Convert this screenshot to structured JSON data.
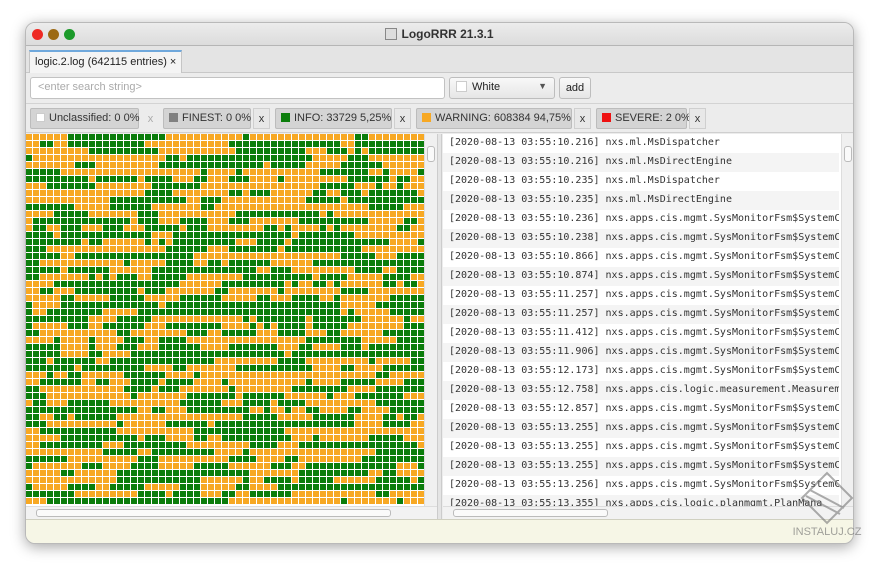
{
  "window": {
    "title": "LogoRRR 21.3.1"
  },
  "tab": {
    "label": "logic.2.log (642115 entries)",
    "close": "×"
  },
  "search": {
    "placeholder": "<enter search string>",
    "color_value": "White",
    "add_label": "add"
  },
  "filters": [
    {
      "label": "Unclassified: 0 0%",
      "color": "#ffffff",
      "close": "x"
    },
    {
      "label": "FINEST: 0 0%",
      "color": "#808080",
      "close": "x"
    },
    {
      "label": "INFO: 33729 5,25%",
      "color": "#0b7d0b",
      "close": "x"
    },
    {
      "label": "WARNING: 608384 94,75%",
      "color": "#f7a823",
      "close": "x"
    },
    {
      "label": "SEVERE: 2 0%",
      "color": "#ee1111",
      "close": "x"
    }
  ],
  "colors": {
    "info": "#0b7d0b",
    "warning": "#f7a823"
  },
  "log_lines": [
    "[2020-08-13 03:55:10.216] nxs.ml.MsDispatcher",
    "[2020-08-13 03:55:10.216] nxs.ml.MsDirectEngine",
    "[2020-08-13 03:55:10.235] nxs.ml.MsDispatcher",
    "[2020-08-13 03:55:10.235] nxs.ml.MsDirectEngine",
    "[2020-08-13 03:55:10.236] nxs.apps.cis.mgmt.SysMonitorFsm$SystemCo",
    "[2020-08-13 03:55:10.238] nxs.apps.cis.mgmt.SysMonitorFsm$SystemCo",
    "[2020-08-13 03:55:10.866] nxs.apps.cis.mgmt.SysMonitorFsm$SystemCo",
    "[2020-08-13 03:55:10.874] nxs.apps.cis.mgmt.SysMonitorFsm$SystemCo",
    "[2020-08-13 03:55:11.257] nxs.apps.cis.mgmt.SysMonitorFsm$SystemCo",
    "[2020-08-13 03:55:11.257] nxs.apps.cis.mgmt.SysMonitorFsm$SystemCo",
    "[2020-08-13 03:55:11.412] nxs.apps.cis.mgmt.SysMonitorFsm$SystemCo",
    "[2020-08-13 03:55:11.906] nxs.apps.cis.mgmt.SysMonitorFsm$SystemCo",
    "[2020-08-13 03:55:12.173] nxs.apps.cis.mgmt.SysMonitorFsm$SystemCo",
    "[2020-08-13 03:55:12.758] nxs.apps.cis.logic.measurement.Measureme",
    "[2020-08-13 03:55:12.857] nxs.apps.cis.mgmt.SysMonitorFsm$SystemCo",
    "[2020-08-13 03:55:13.255] nxs.apps.cis.mgmt.SysMonitorFsm$SystemCo",
    "[2020-08-13 03:55:13.255] nxs.apps.cis.mgmt.SysMonitorFsm$SystemCo",
    "[2020-08-13 03:55:13.255] nxs.apps.cis.mgmt.SysMonitorFsm$SystemCo",
    "[2020-08-13 03:55:13.256] nxs.apps.cis.mgmt.SysMonitorFsm$SystemCo",
    "[2020-08-13 03:55:13.355] nxs.apps.cis.logic.planmgmt.PlanMana"
  ],
  "watermark": "INSTALUJ.CZ"
}
